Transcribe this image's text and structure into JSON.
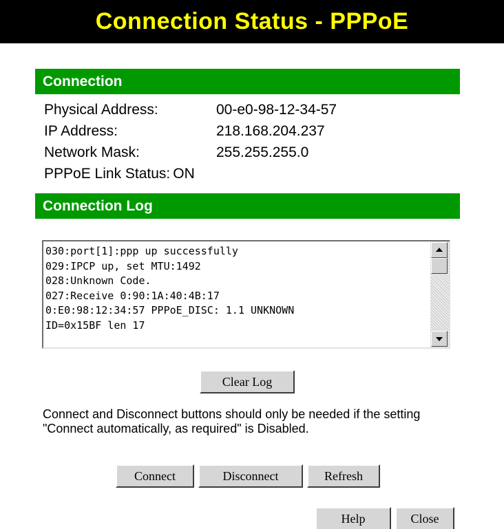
{
  "title": "Connection Status - PPPoE",
  "colors": {
    "title_bg": "#000000",
    "title_text": "#ffff00",
    "section_bg": "#009900",
    "section_text": "#ffffff"
  },
  "connection": {
    "heading": "Connection",
    "rows": [
      {
        "label": "Physical Address:",
        "value": "00-e0-98-12-34-57"
      },
      {
        "label": "IP Address:",
        "value": "218.168.204.237"
      },
      {
        "label": "Network Mask:",
        "value": "255.255.255.0"
      },
      {
        "label": "PPPoE Link Status:",
        "value": "ON"
      }
    ]
  },
  "log": {
    "heading": "Connection Log",
    "lines": [
      "030:port[1]:ppp up successfully",
      "029:IPCP up, set MTU:1492",
      "028:Unknown Code.",
      "027:Receive 0:90:1A:40:4B:17",
      "0:E0:98:12:34:57 PPPoE_DISC: 1.1 UNKNOWN",
      "ID=0x15BF len 17"
    ],
    "clear_label": "Clear Log"
  },
  "note": "Connect and Disconnect buttons should only be needed if the setting \"Connect automatically, as required\" is Disabled.",
  "buttons": {
    "connect": "Connect",
    "disconnect": "Disconnect",
    "refresh": "Refresh",
    "help": "Help",
    "close": "Close"
  }
}
